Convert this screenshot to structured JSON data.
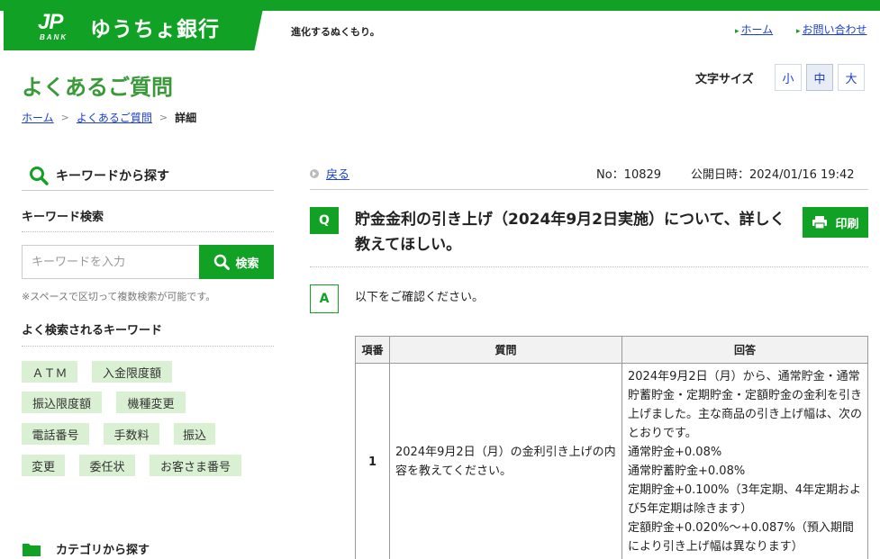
{
  "header": {
    "logo_mark": "JP",
    "logo_sub": "BANK",
    "bank_name": "ゆうちょ銀行",
    "tagline": "進化するぬくもり。",
    "links": [
      "ホーム",
      "お問い合わせ"
    ]
  },
  "page_title": "よくあるご質問",
  "font_size": {
    "label": "文字サイズ",
    "options": [
      "小",
      "中",
      "大"
    ],
    "selected": "中"
  },
  "breadcrumb": {
    "items": [
      "ホーム",
      "よくあるご質問"
    ],
    "current": "詳細"
  },
  "sidebar": {
    "keyword_heading": "キーワードから探す",
    "keyword_search_label": "キーワード検索",
    "search_placeholder": "キーワードを入力",
    "search_button": "検索",
    "search_note": "※スペースで区切って複数検索が可能です。",
    "frequent_heading": "よく検索されるキーワード",
    "frequent_keywords": [
      "ＡＴＭ",
      "入金限度額",
      "振込限度額",
      "機種変更",
      "電話番号",
      "手数料",
      "振込",
      "変更",
      "委任状",
      "お客さま番号"
    ],
    "category_heading": "カテゴリから探す"
  },
  "main": {
    "back_label": "戻る",
    "number_label": "No：10829",
    "published_label": "公開日時：2024/01/16 19:42",
    "q_badge": "Q",
    "question": "貯金金利の引き上げ（2024年9月2日実施）について、詳しく教えてほしい。",
    "print_label": "印刷",
    "a_badge": "A",
    "answer_intro": "以下をご確認ください。",
    "table": {
      "headers": [
        "項番",
        "質問",
        "回答"
      ],
      "rows": [
        {
          "num": "1",
          "question": "2024年9月2日（月）の金利引き上げの内容を教えてください。",
          "answer_lines": [
            "2024年9月2日（月）から、通常貯金・通常貯蓄貯金・定期貯金・定額貯金の金利を引き上げました。主な商品の引き上げ幅は、次のとおりです。",
            "通常貯金+0.08%",
            "通常貯蓄貯金+0.08%",
            "定期貯金+0.100%（3年定期、4年定期および5年定期は除きます）",
            "定額貯金+0.020%～+0.087%（預入期間により引き上げ幅は異なります）"
          ]
        }
      ]
    }
  },
  "colors": {
    "brand_green": "#11a124",
    "link_blue": "#1a3fd0",
    "tag_bg": "#d9f0d2"
  }
}
